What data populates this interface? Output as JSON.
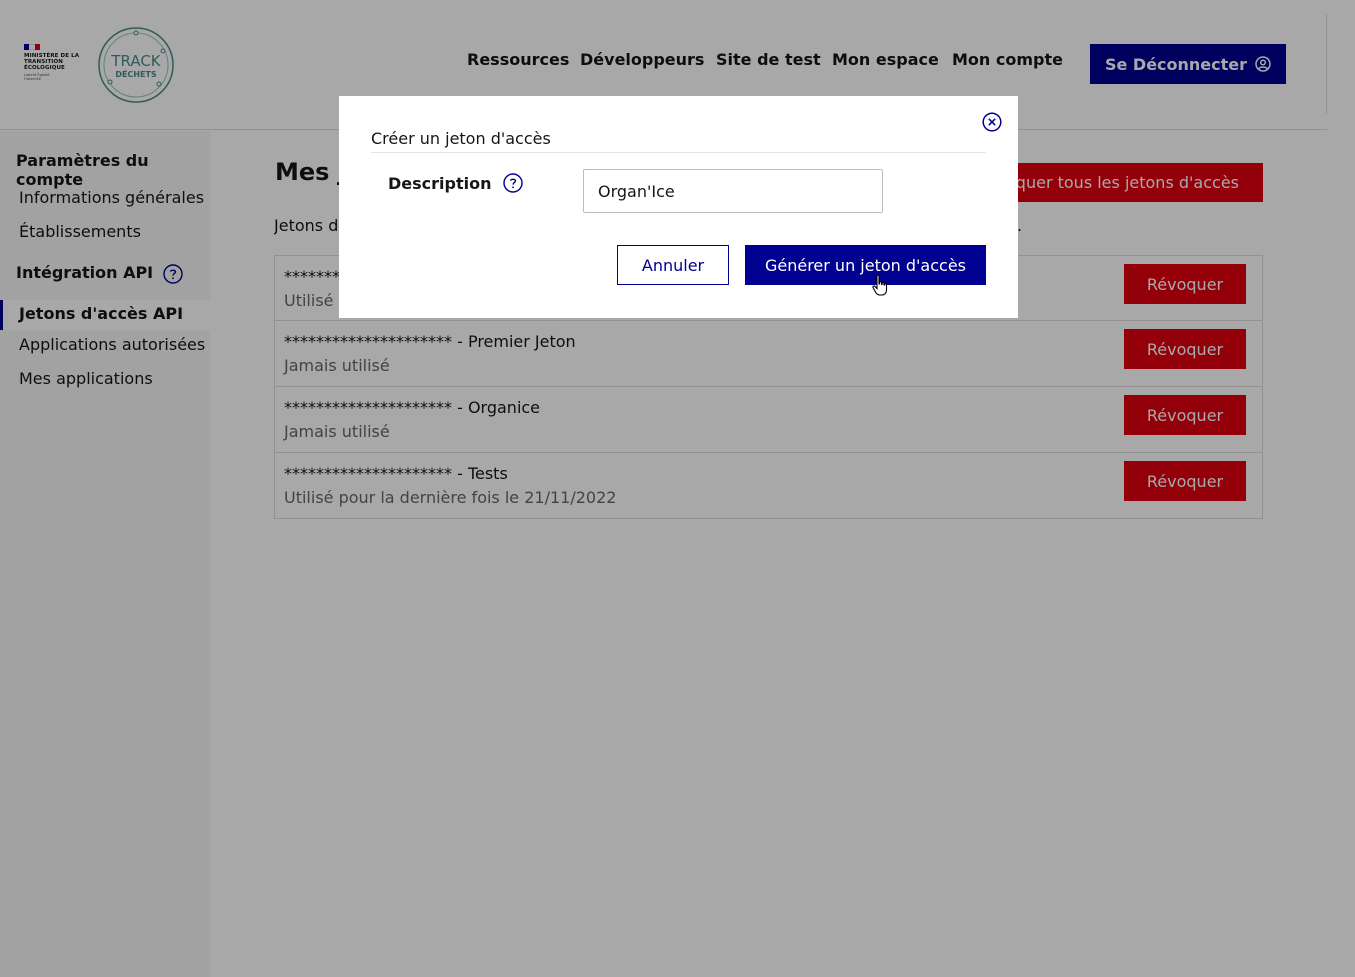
{
  "header": {
    "ministry": "MINISTÈRE DE LA TRANSITION ÉCOLOGIQUE",
    "motto": "Liberté Égalité Fraternité",
    "logo_line1": "TRACK",
    "logo_line2": "DÉCHETS",
    "nav": [
      "Ressources",
      "Développeurs",
      "Site de test",
      "Mon espace",
      "Mon compte"
    ],
    "logout_label": "Se Déconnecter"
  },
  "sidebar": {
    "section1": "Paramètres du compte",
    "items1": [
      "Informations générales",
      "Établissements"
    ],
    "section2": "Intégration API",
    "active_item": "Jetons d'accès API",
    "items2": [
      "Applications autorisées",
      "Mes applications"
    ]
  },
  "main": {
    "title": "Mes je",
    "revoke_all_label": "oquer tous les jetons d'accès",
    "subtitle": "Jetons d'",
    "subtitle_end": ".",
    "tokens": [
      {
        "name": "*********",
        "used": "Utilisé p",
        "revoke": "Révoquer"
      },
      {
        "name": "********************* - Premier Jeton",
        "used": "Jamais utilisé",
        "revoke": "Révoquer"
      },
      {
        "name": "********************* - Organice",
        "used": "Jamais utilisé",
        "revoke": "Révoquer"
      },
      {
        "name": "********************* - Tests",
        "used": "Utilisé pour la dernière fois le 21/11/2022",
        "revoke": "Révoquer"
      }
    ]
  },
  "modal": {
    "title": "Créer un jeton d'accès",
    "description_label": "Description",
    "description_value": "Organ'Ice",
    "cancel_label": "Annuler",
    "generate_label": "Générer un jeton d'accès"
  },
  "colors": {
    "primary": "#000091",
    "danger": "#e1000f"
  }
}
